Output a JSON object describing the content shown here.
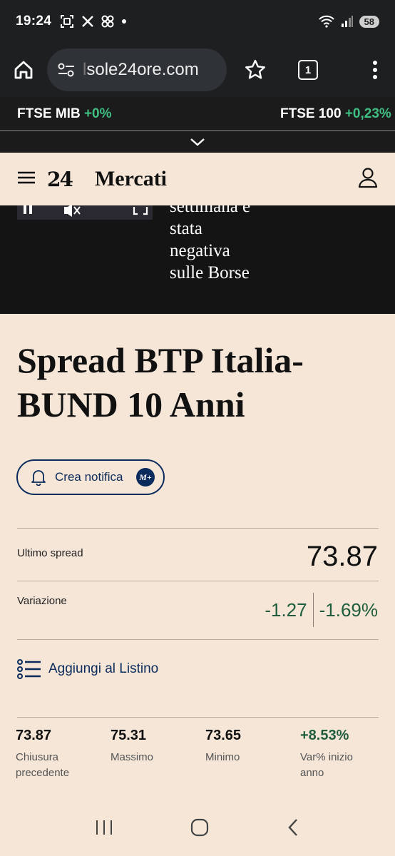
{
  "status_bar": {
    "time": "19:24",
    "battery": "58",
    "icons": [
      "screenshot-icon",
      "x-icon",
      "pinwheel-icon",
      "dot-icon",
      "wifi-icon",
      "signal-icon"
    ]
  },
  "browser": {
    "url_faded": "l",
    "url": "sole24ore.com",
    "tab_count": "1"
  },
  "ticker": [
    {
      "name": "FTSE MIB",
      "change": "+0%"
    },
    {
      "name": "FTSE 100",
      "change": "+0,23%"
    }
  ],
  "header": {
    "logo": "24",
    "title": "Mercati"
  },
  "video": {
    "caption_lines": [
      "settimana è",
      "stata",
      "negativa",
      "sulle Borse"
    ]
  },
  "page": {
    "title": "Spread BTP Italia-BUND 10 Anni",
    "notify_label": "Crea notifica",
    "notify_badge": "M+",
    "last_spread_label": "Ultimo spread",
    "last_spread_value": "73.87",
    "variation_label": "Variazione",
    "variation_abs": "-1.27",
    "variation_pct": "-1.69%",
    "add_list_label": "Aggiungi al Listino"
  },
  "stats": [
    {
      "value": "73.87",
      "label": "Chiusura precedente"
    },
    {
      "value": "75.31",
      "label": "Massimo"
    },
    {
      "value": "73.65",
      "label": "Minimo"
    },
    {
      "value": "+8.53%",
      "label": "Var% inizio anno"
    }
  ],
  "colors": {
    "background": "#f5e6d8",
    "dark": "#1d1f21",
    "navy": "#0b2b5c",
    "positive_green": "#1f5d3c",
    "ticker_green": "#3fbf83"
  }
}
